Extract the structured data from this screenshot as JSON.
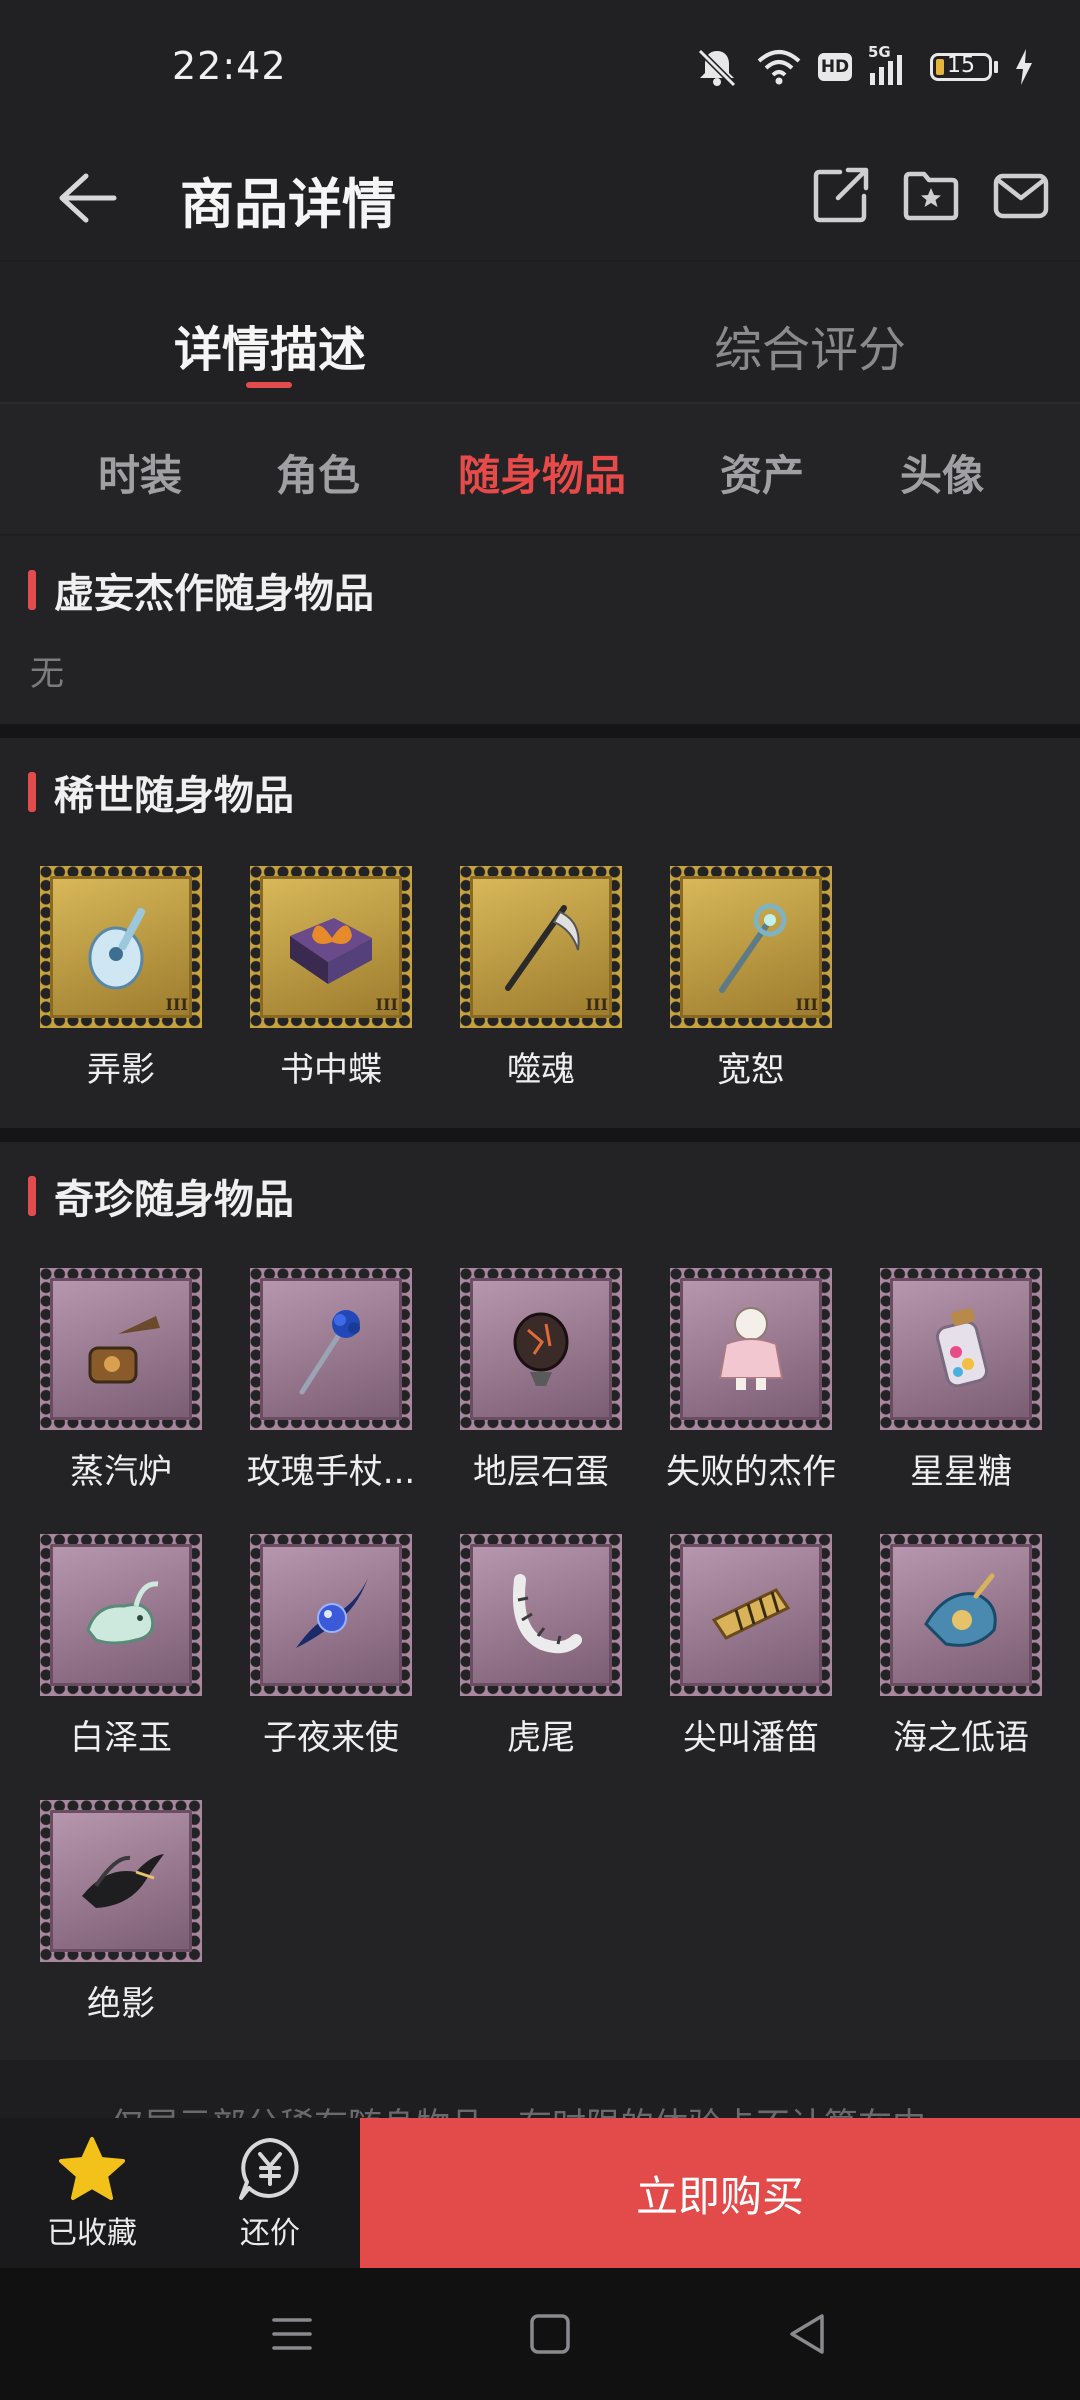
{
  "status_bar": {
    "time": "22:42",
    "battery_level": "15",
    "network_badge": "HD",
    "network_type": "5G",
    "icons": [
      "mute-icon",
      "wifi-icon",
      "hd-icon",
      "signal-5g-icon",
      "battery-icon",
      "charging-icon"
    ]
  },
  "header": {
    "title": "商品详情",
    "icons": [
      "back-arrow-icon",
      "share-icon",
      "favorite-folder-icon",
      "mail-icon"
    ]
  },
  "tabs": [
    {
      "label": "详情描述",
      "active": true
    },
    {
      "label": "综合评分",
      "active": false
    }
  ],
  "categories": [
    {
      "label": "时装",
      "active": false
    },
    {
      "label": "角色",
      "active": false
    },
    {
      "label": "随身物品",
      "active": true
    },
    {
      "label": "资产",
      "active": false
    },
    {
      "label": "头像",
      "active": false
    }
  ],
  "sections": {
    "masterpiece": {
      "title": "虚妄杰作随身物品",
      "empty_text": "无"
    },
    "rare": {
      "title": "稀世随身物品",
      "items": [
        {
          "name": "弄影",
          "icon": "instrument-icon"
        },
        {
          "name": "书中蝶",
          "icon": "butterfly-book-icon"
        },
        {
          "name": "噬魂",
          "icon": "scythe-icon"
        },
        {
          "name": "宽恕",
          "icon": "staff-icon"
        }
      ]
    },
    "treasure": {
      "title": "奇珍随身物品",
      "items": [
        {
          "name": "蒸汽炉",
          "icon": "steam-furnace-icon"
        },
        {
          "name": "玫瑰手杖...",
          "icon": "rose-cane-icon"
        },
        {
          "name": "地层石蛋",
          "icon": "stone-egg-icon"
        },
        {
          "name": "失败的杰作",
          "icon": "doll-icon"
        },
        {
          "name": "星星糖",
          "icon": "candy-jar-icon"
        },
        {
          "name": "白泽玉",
          "icon": "jade-beast-icon"
        },
        {
          "name": "子夜来使",
          "icon": "midnight-orb-icon"
        },
        {
          "name": "虎尾",
          "icon": "tiger-tail-icon"
        },
        {
          "name": "尖叫潘笛",
          "icon": "pan-flute-icon"
        },
        {
          "name": "海之低语",
          "icon": "seashell-icon"
        },
        {
          "name": "绝影",
          "icon": "bird-icon"
        }
      ]
    }
  },
  "footnote_partial": "仅展示部分稀有随身物品，有时限的体验卡不计算在内",
  "bottom_bar": {
    "favorite_label": "已收藏",
    "bargain_label": "还价",
    "buy_label": "立即购买",
    "colors": {
      "accent": "#e34b4b",
      "favorite_star": "#f2c21b"
    }
  },
  "nav_bar": {
    "icons": [
      "menu-icon",
      "home-icon",
      "back-icon"
    ]
  }
}
